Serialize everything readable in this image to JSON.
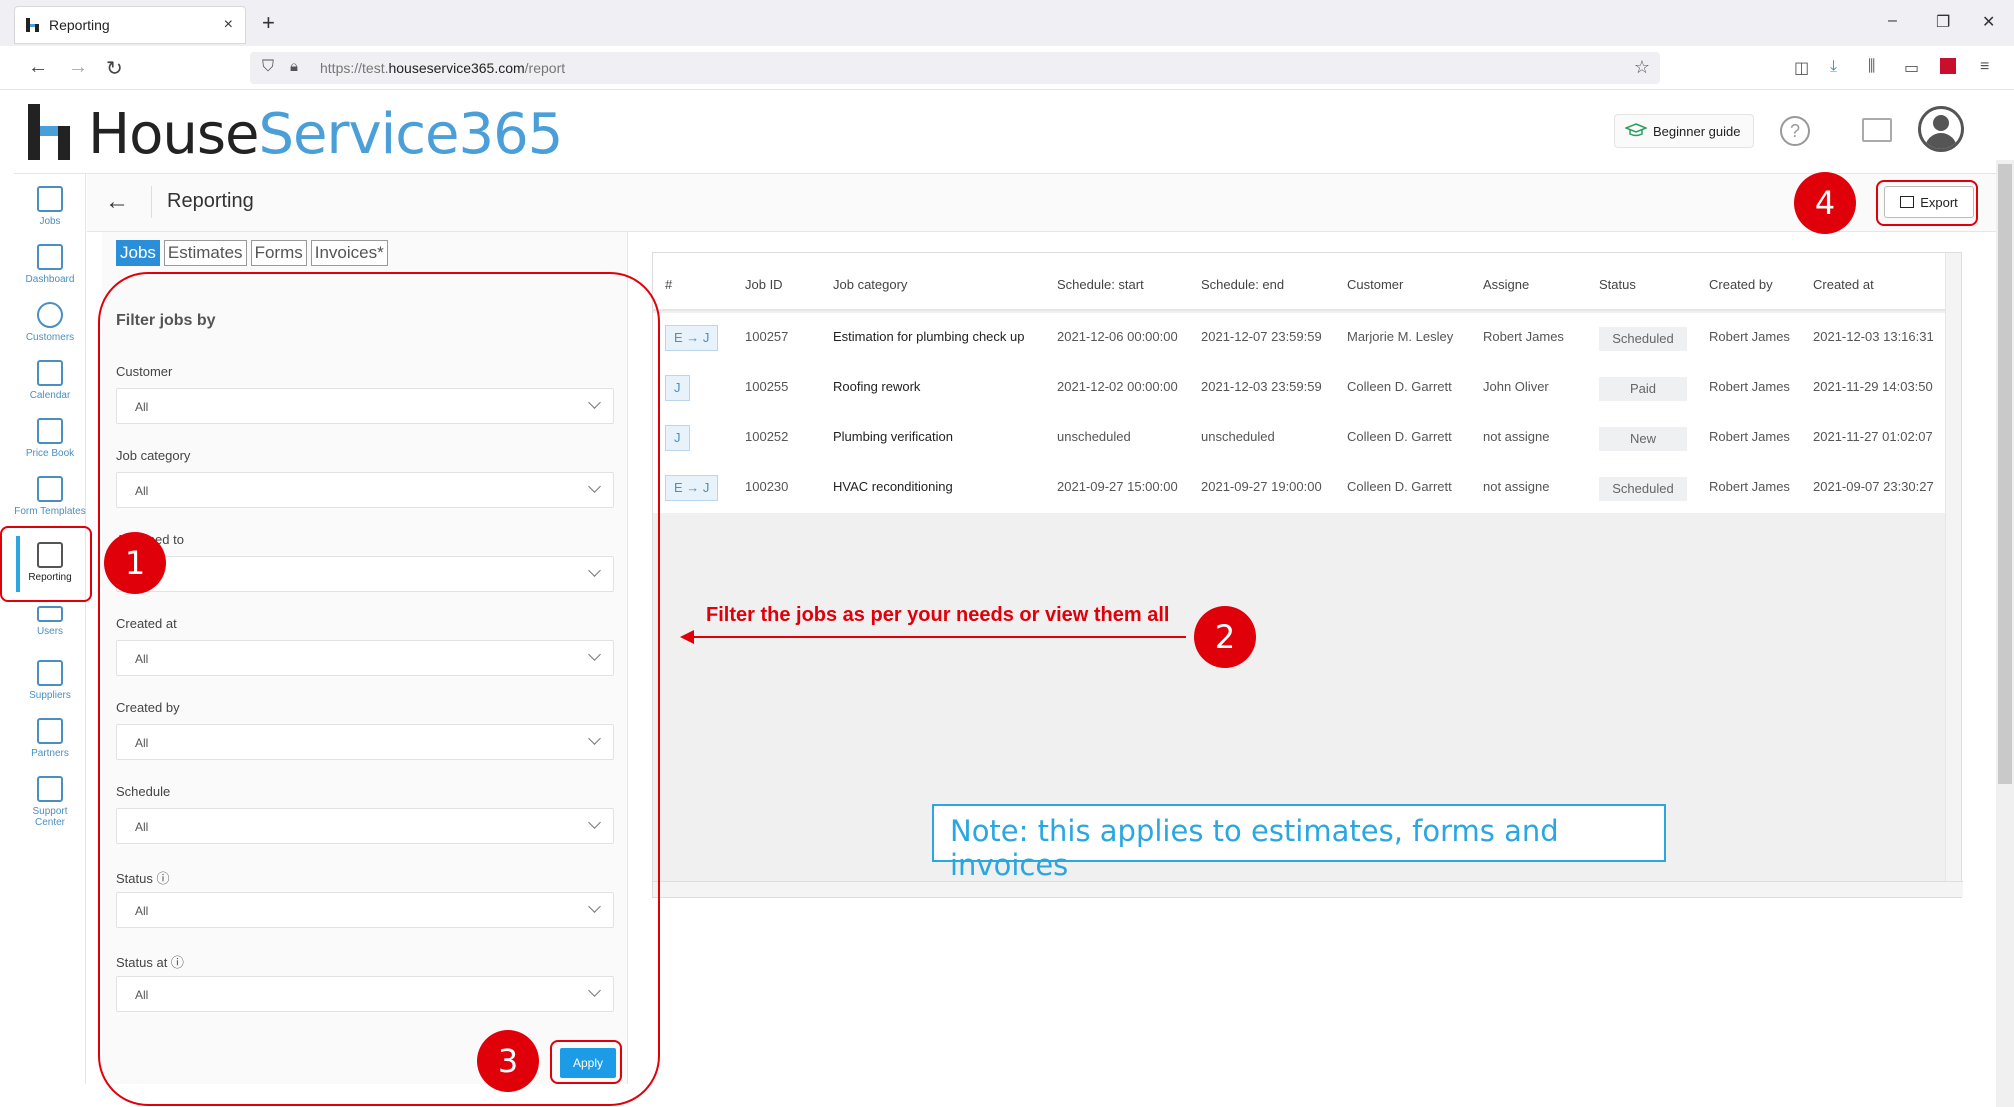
{
  "browser": {
    "tab_title": "Reporting",
    "tab_close": "×",
    "new_tab": "+",
    "url_prefix": "https://test.",
    "url_domain": "houseservice365.com",
    "url_path": "/report",
    "min": "–",
    "max": "❐",
    "close": "✕"
  },
  "header": {
    "logo_house": "House",
    "logo_service": "Service365",
    "beginner_guide": "Beginner guide",
    "help": "?"
  },
  "sidebar": {
    "items": [
      {
        "label": "Jobs",
        "icon": "tools-icon"
      },
      {
        "label": "Dashboard",
        "icon": "bar-chart-icon"
      },
      {
        "label": "Customers",
        "icon": "target-icon"
      },
      {
        "label": "Calendar",
        "icon": "calendar-icon"
      },
      {
        "label": "Price Book",
        "icon": "price-tag-icon"
      },
      {
        "label": "Form Templates",
        "icon": "form-icon"
      },
      {
        "label": "Reporting",
        "icon": "report-icon"
      },
      {
        "label": "Users",
        "icon": "users-icon"
      },
      {
        "label": "Suppliers",
        "icon": "truck-icon"
      },
      {
        "label": "Partners",
        "icon": "partners-icon"
      },
      {
        "label": "Support Center",
        "icon": "support-icon"
      }
    ]
  },
  "page": {
    "back": "←",
    "title": "Reporting",
    "export_label": "Export"
  },
  "filters": {
    "tabs": [
      "Jobs",
      "Estimates",
      "Forms",
      "Invoices*"
    ],
    "heading": "Filter jobs by",
    "fields": [
      {
        "label": "Customer",
        "value": "All"
      },
      {
        "label": "Job category",
        "value": "All"
      },
      {
        "label": "Assigned to",
        "value": ""
      },
      {
        "label": "Created at",
        "value": "All"
      },
      {
        "label": "Created by",
        "value": "All"
      },
      {
        "label": "Schedule",
        "value": "All"
      },
      {
        "label": "Status ⓘ",
        "value": "All"
      },
      {
        "label": "Status at ⓘ",
        "value": "All"
      }
    ],
    "apply_label": "Apply"
  },
  "table": {
    "columns": [
      "#",
      "Job ID",
      "Job category",
      "Schedule: start",
      "Schedule: end",
      "Customer",
      "Assigne",
      "Status",
      "Created by",
      "Created at"
    ],
    "rows": [
      {
        "type": "E → J",
        "id": "100257",
        "category": "Estimation for plumbing check up",
        "start": "2021-12-06 00:00:00",
        "end": "2021-12-07 23:59:59",
        "customer": "Marjorie M. Lesley",
        "assignee": "Robert James",
        "status": "Scheduled",
        "created_by": "Robert James",
        "created_at": "2021-12-03 13:16:31"
      },
      {
        "type": "J",
        "id": "100255",
        "category": "Roofing rework",
        "start": "2021-12-02 00:00:00",
        "end": "2021-12-03 23:59:59",
        "customer": "Colleen D. Garrett",
        "assignee": "John Oliver",
        "status": "Paid",
        "created_by": "Robert James",
        "created_at": "2021-11-29 14:03:50"
      },
      {
        "type": "J",
        "id": "100252",
        "category": "Plumbing verification",
        "start": "unscheduled",
        "end": "unscheduled",
        "customer": "Colleen D. Garrett",
        "assignee": "not assigne",
        "status": "New",
        "created_by": "Robert James",
        "created_at": "2021-11-27 01:02:07"
      },
      {
        "type": "E → J",
        "id": "100230",
        "category": "HVAC reconditioning",
        "start": "2021-09-27 15:00:00",
        "end": "2021-09-27 19:00:00",
        "customer": "Colleen D. Garrett",
        "assignee": "not assigne",
        "status": "Scheduled",
        "created_by": "Robert James",
        "created_at": "2021-09-07 23:30:27"
      }
    ]
  },
  "annotations": {
    "step1": "1",
    "step2": "2",
    "step3": "3",
    "step4": "4",
    "filter_text": "Filter the jobs as per your needs or view them all",
    "note_text": "Note: this applies to estimates, forms and invoices"
  },
  "colors": {
    "accent": "#2a8fd8",
    "annotation_red": "#e0000a",
    "note_blue": "#2aa7e0"
  }
}
